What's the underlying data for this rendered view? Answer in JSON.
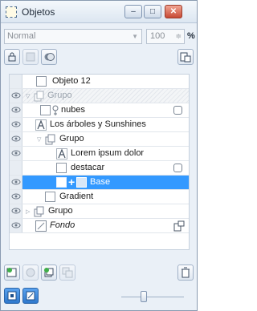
{
  "window": {
    "title": "Objetos"
  },
  "titlebar_buttons": {
    "minimize": "▭",
    "restore": "▭",
    "close": "x"
  },
  "blend": {
    "mode": "Normal",
    "opacity": "100",
    "percent": "%"
  },
  "toolbar": [
    "lock-icon",
    "lock-transparency-icon",
    "mask-icon",
    "options-icon"
  ],
  "layers": [
    {
      "name": "Objeto 12",
      "visible": false,
      "style": "normal"
    },
    {
      "name": "Grupo",
      "visible": true,
      "style": "muted",
      "expanded": true
    },
    {
      "name": "nubes",
      "visible": true,
      "style": "normal",
      "mask": true
    },
    {
      "name": "Los árboles y Sunshines",
      "visible": true,
      "style": "normal"
    },
    {
      "name": "Grupo",
      "visible": true,
      "style": "normal",
      "expanded": true
    },
    {
      "name": "Lorem ipsum dolor",
      "visible": true,
      "style": "normal"
    },
    {
      "name": "destacar",
      "visible": false,
      "style": "normal",
      "mask": true
    },
    {
      "name": "Base",
      "visible": true,
      "style": "normal",
      "selected": true
    },
    {
      "name": "Gradient",
      "visible": true,
      "style": "normal"
    },
    {
      "name": "Grupo",
      "visible": true,
      "style": "normal",
      "expanded": false
    },
    {
      "name": "Fondo",
      "visible": true,
      "style": "italic"
    }
  ],
  "bottom_actions": [
    "new-layer-icon",
    "new-object-icon",
    "new-group-icon",
    "duplicate-icon",
    "delete-icon"
  ],
  "view_actions": [
    "view-objects-icon",
    "view-masks-icon"
  ],
  "colors": {
    "selection": "#3399ff",
    "panel": "#eaf0f7",
    "border": "#8a9bb1"
  }
}
